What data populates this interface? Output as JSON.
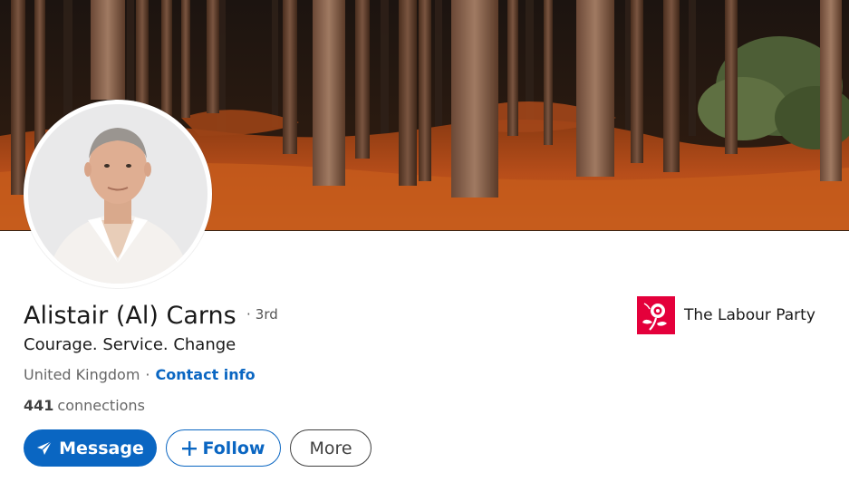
{
  "profile": {
    "name": "Alistair (Al) Carns",
    "degree_separator": "·",
    "degree": "3rd",
    "headline": "Courage. Service. Change",
    "location": "United Kingdom",
    "location_separator": "·",
    "contact_info_label": "Contact info",
    "connections_count": "441",
    "connections_label": "connections"
  },
  "actions": {
    "message_label": "Message",
    "follow_label": "Follow",
    "more_label": "More"
  },
  "organization": {
    "name": "The Labour Party"
  },
  "icons": {
    "message": "paper-plane-icon",
    "follow": "plus-icon",
    "org_logo": "labour-rose-logo"
  },
  "colors": {
    "primary_blue": "#0a66c2",
    "labour_red": "#e4003b",
    "text_primary": "#191919",
    "text_secondary": "#666666"
  }
}
